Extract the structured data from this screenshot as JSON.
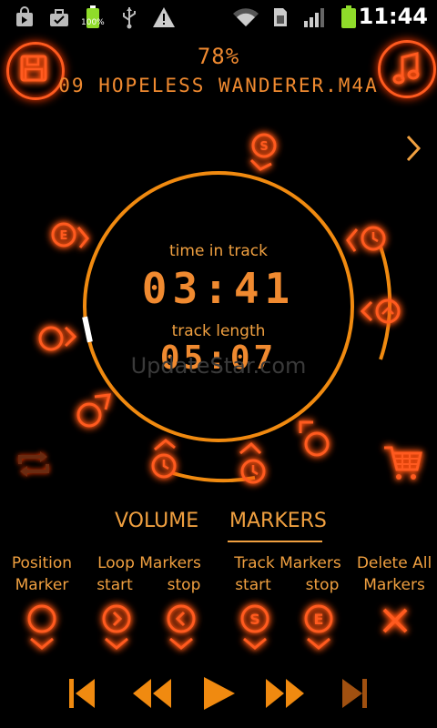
{
  "status_bar": {
    "time": "11:44",
    "battery_label": "100%",
    "icons": [
      "bag-icon",
      "briefcase-icon",
      "battery-icon",
      "usb-icon",
      "warning-icon",
      "wifi-icon",
      "sim-icon",
      "signal-icon",
      "battery-full-icon"
    ]
  },
  "player": {
    "percent": "78%",
    "track_name": "09 HOPELESS WANDERER.M4A",
    "time_in_track_label": "time in track",
    "time_in_track": "03:41",
    "track_length_label": "track length",
    "track_length": "05:07",
    "watermark": "UpdateStar.com"
  },
  "tabs": [
    {
      "label": "VOLUME"
    },
    {
      "label": "MARKERS"
    }
  ],
  "markers_panel": {
    "position_marker": "Position\nMarker",
    "loop_markers_title": "Loop Markers",
    "loop_start": "start",
    "loop_stop": "stop",
    "track_markers_title": "Track Markers",
    "track_start": "start",
    "track_stop": "stop",
    "delete_all": "Delete All\nMarkers"
  },
  "colors": {
    "accent": "#f0a040",
    "glow": "#ff3a00",
    "ring": "#f08a10"
  }
}
